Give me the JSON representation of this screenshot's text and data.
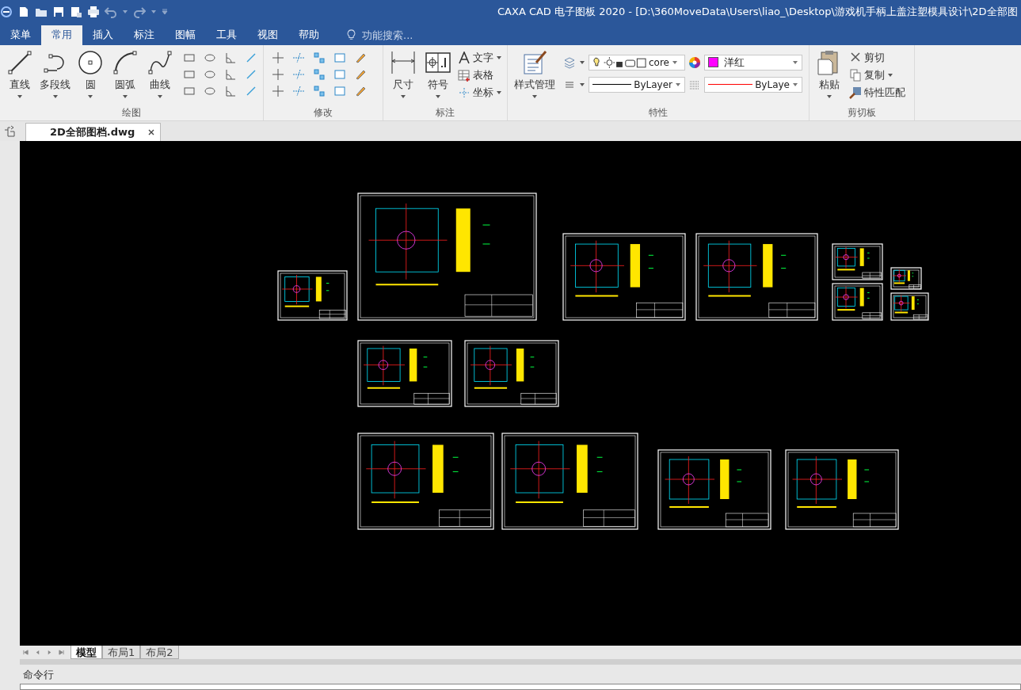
{
  "title_bar": {
    "title": "CAXA CAD 电子图板 2020 - [D:\\360MoveData\\Users\\liao_\\Desktop\\游戏机手柄上盖注塑模具设计\\2D全部图"
  },
  "ribbon_tabs": [
    {
      "label": "菜单",
      "selected": false
    },
    {
      "label": "常用",
      "selected": true
    },
    {
      "label": "插入",
      "selected": false
    },
    {
      "label": "标注",
      "selected": false
    },
    {
      "label": "图幅",
      "selected": false
    },
    {
      "label": "工具",
      "selected": false
    },
    {
      "label": "视图",
      "selected": false
    },
    {
      "label": "帮助",
      "selected": false
    }
  ],
  "search": {
    "placeholder": "功能搜索..."
  },
  "draw_group": {
    "label": "绘图",
    "buttons": [
      {
        "label": "直线"
      },
      {
        "label": "多段线"
      },
      {
        "label": "圆"
      },
      {
        "label": "圆弧"
      },
      {
        "label": "曲线"
      }
    ]
  },
  "modify_group": {
    "label": "修改"
  },
  "annotate_group": {
    "label": "标注",
    "buttons": [
      {
        "label": "尺寸"
      },
      {
        "label": "符号"
      }
    ],
    "items": [
      {
        "label": "文字"
      },
      {
        "label": "表格"
      },
      {
        "label": "坐标"
      }
    ]
  },
  "properties_group": {
    "label": "特性",
    "style_button": "样式管理",
    "layer": "core",
    "color": {
      "label": "洋红",
      "color": "#ff00ff"
    },
    "linetype": "ByLayer",
    "lineweight": "ByLaye"
  },
  "clipboard_group": {
    "label": "剪切板",
    "paste": "粘贴",
    "items": [
      {
        "label": "剪切"
      },
      {
        "label": "复制"
      },
      {
        "label": "特性匹配"
      }
    ]
  },
  "document_tabs": [
    {
      "label": "2D全部图档.dwg",
      "selected": true
    }
  ],
  "layout_tabs": [
    {
      "label": "模型",
      "selected": true
    },
    {
      "label": "布局1",
      "selected": false
    },
    {
      "label": "布局2",
      "selected": false
    }
  ],
  "command_line": {
    "label": "命令行"
  }
}
